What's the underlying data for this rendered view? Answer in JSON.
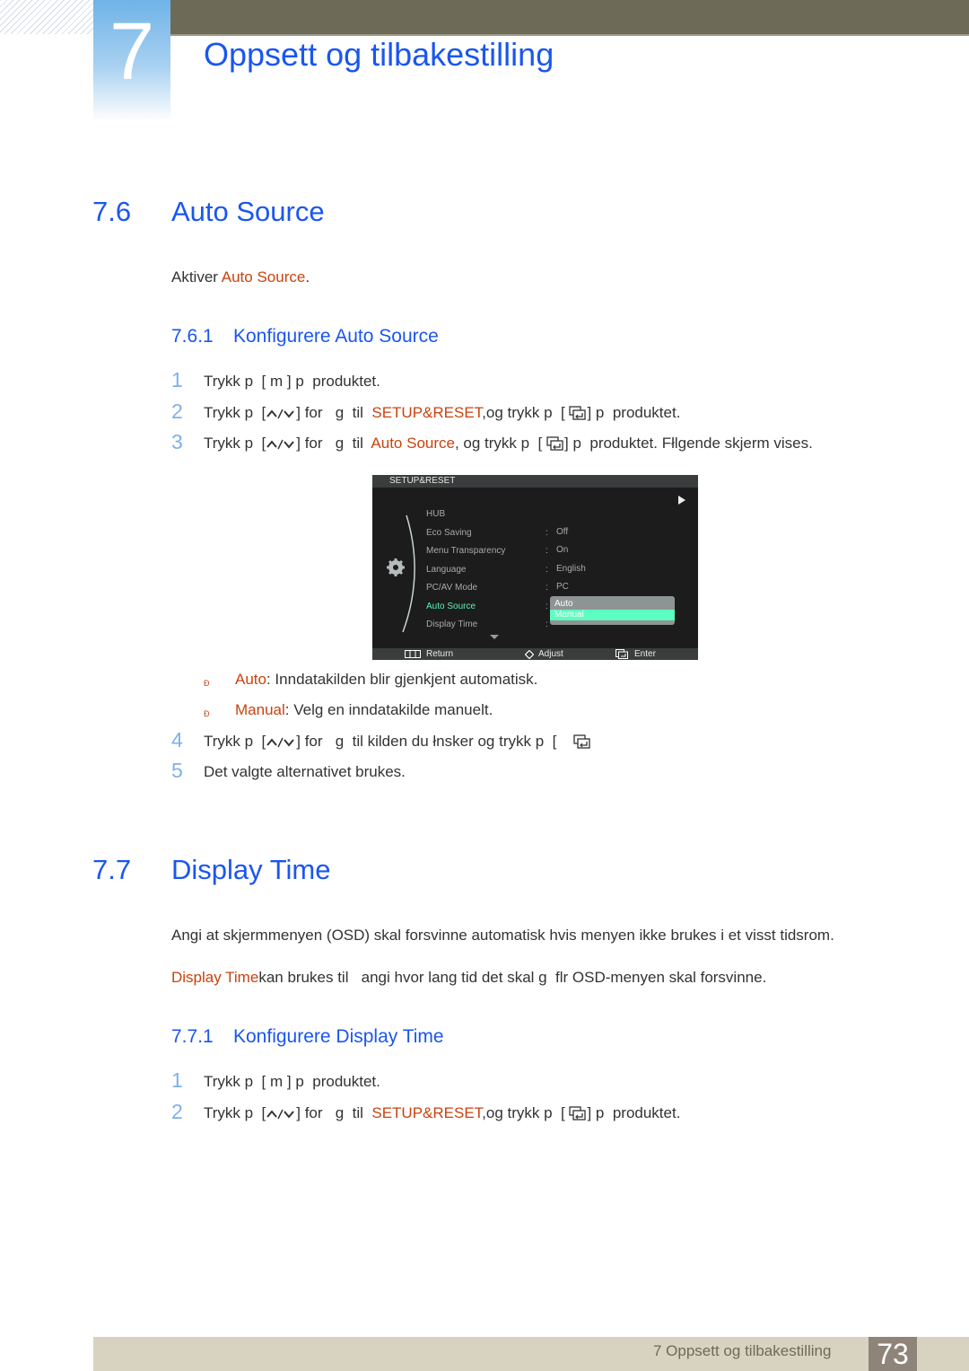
{
  "header": {
    "chapter_number": "7",
    "chapter_title": "Oppsett og tilbakestilling"
  },
  "section_7_6": {
    "number": "7.6",
    "title": "Auto Source",
    "intro_prefix": "Aktiver ",
    "intro_highlight": "Auto Source",
    "intro_suffix": ".",
    "subsection": {
      "number": "7.6.1",
      "title": "Konfigurere Auto Source"
    },
    "steps": [
      {
        "num": "1",
        "a": "Trykk p  [ ",
        "key": "m",
        "b": " ] p  produktet."
      },
      {
        "num": "2",
        "a": "Trykk p  [",
        "b": "] for   g  til  ",
        "hl": "SETUP&RESET",
        "c": ",og trykk p  [ ",
        "d": "] p  produktet."
      },
      {
        "num": "3",
        "a": "Trykk p  [",
        "b": "] for   g  til  ",
        "hl": "Auto Source",
        "c": ", og trykk p  [ ",
        "d": "] p  produktet. Fłlgende skjerm vises."
      },
      {
        "num": "4",
        "a": "Trykk p  [",
        "b": "] for   g  til kilden du łnsker og trykk p  [ "
      },
      {
        "num": "5",
        "a": "Det valgte alternativet brukes."
      }
    ],
    "bullets": [
      {
        "marker": "Ð",
        "hl": "Auto",
        "text": ": Inndatakilden blir gjenkjent automatisk."
      },
      {
        "marker": "Ð",
        "hl": "Manual",
        "text": ": Velg en inndatakilde manuelt."
      }
    ]
  },
  "osd": {
    "title": "SETUP&RESET",
    "items": [
      {
        "label": "HUB",
        "value": ""
      },
      {
        "label": "Eco Saving",
        "value": "Off"
      },
      {
        "label": "Menu Transparency",
        "value": "On"
      },
      {
        "label": "Language",
        "value": "English"
      },
      {
        "label": "PC/AV Mode",
        "value": "PC"
      },
      {
        "label": "Auto Source",
        "value": ""
      },
      {
        "label": "Display Time",
        "value": ""
      }
    ],
    "colon": ":",
    "dropdown_options": [
      "Auto",
      "Manual"
    ],
    "selected_option": "Manual",
    "bottom": {
      "return": "Return",
      "adjust": "Adjust",
      "enter": "Enter"
    },
    "colors": {
      "active": "#5cf0b0",
      "highlight_bg": "#5cffbf",
      "item": "#a9a9a9"
    }
  },
  "section_7_7": {
    "number": "7.7",
    "title": "Display Time",
    "para1": "Angi at skjermmenyen (OSD) skal forsvinne automatisk hvis menyen ikke brukes i et visst tidsrom.",
    "para2_hl": "Display Time",
    "para2_text": "kan brukes til   angi hvor lang tid det skal g  flr OSD-menyen skal forsvinne.",
    "subsection": {
      "number": "7.7.1",
      "title": "Konfigurere Display Time"
    },
    "steps": [
      {
        "num": "1",
        "a": "Trykk p  [ ",
        "key": "m",
        "b": " ] p  produktet."
      },
      {
        "num": "2",
        "a": "Trykk p  [",
        "b": "] for   g  til  ",
        "hl": "SETUP&RESET",
        "c": ",og trykk p  [ ",
        "d": "] p  produktet."
      }
    ]
  },
  "footer": {
    "chapter_label": "7 Oppsett og tilbakestilling",
    "page_number": "73"
  },
  "colors": {
    "heading_blue": "#1a56f0",
    "highlight_orange": "#c9420f",
    "step_number": "#7fb0ea",
    "topbar": "#6d6b58",
    "footer_bar": "#d8d3c1",
    "page_box": "#8e847a"
  }
}
